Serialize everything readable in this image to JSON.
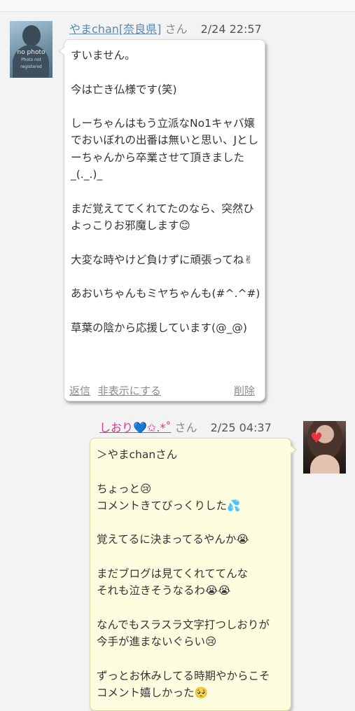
{
  "top_strip_text": "· · ·",
  "comments": [
    {
      "name": "やまchan[奈良県]",
      "suffix": "さん",
      "time": "2/24 22:57",
      "avatar_text": "no photo",
      "avatar_subtext": "Photo not registered",
      "message": "すいません。\n\n今は亡き仏様です(笑)\n\nしーちゃんはもう立派なNo1キャバ嬢でおいぼれの出番は無いと思い、Jとしーちゃんから卒業させて頂きました_(._.)_\n\nまだ覚えててくれてたのなら、突然ひよっこりお邪魔します😊\n\n大変な時やけど負けずに頑張ってね✌\n\nあおいちゃんもミヤちゃんも(#^.^#)\n\n草葉の陰から応援しています(@_@)",
      "actions": {
        "reply": "返信",
        "hide": "非表示にする",
        "delete": "削除"
      }
    },
    {
      "name": "しおり💙✩.*˚",
      "suffix": "さん",
      "time": "2/25 04:37",
      "message": "＞やまchanさん\n\nちょっと😢\nコメントきてびっくりした💦\n\n覚えてるに決まってるやんか😭\n\nまだブログは見てくれててんな\nそれも泣きそうなるわ😭😭\n\nなんでもスラスラ文字打つしおりが\n今手が進まないぐらい😢\n\nずっとお休みしてる時期やからこそ\nコメント嬉しかった🥺"
    }
  ],
  "colors": {
    "link": "#5a87b8",
    "owner_name": "#e0338f",
    "owner_bubble": "#fffde0",
    "visitor_bubble": "#ffffff"
  }
}
